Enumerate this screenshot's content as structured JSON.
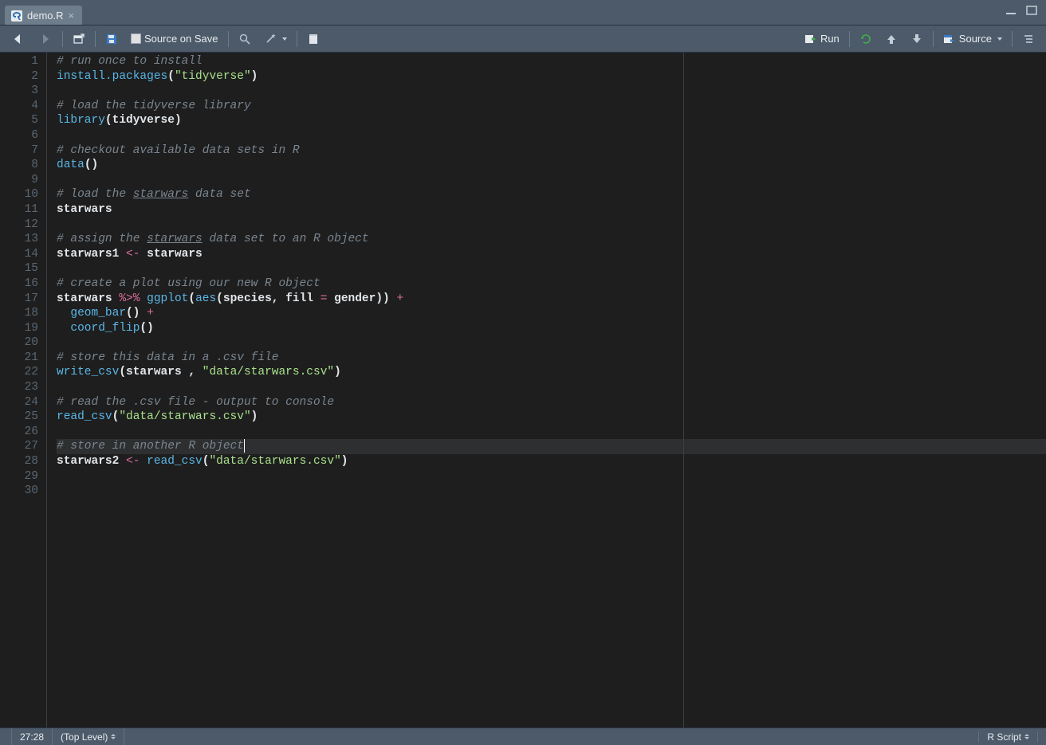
{
  "tab": {
    "filename": "demo.R"
  },
  "toolbar": {
    "source_on_save": "Source on Save",
    "run": "Run",
    "source": "Source"
  },
  "status": {
    "cursor_pos": "27:28",
    "scope": "(Top Level)",
    "file_type": "R Script"
  },
  "editor": {
    "active_line": 27,
    "total_lines": 30,
    "margin_col": 80,
    "lines": [
      {
        "n": 1,
        "tokens": [
          {
            "t": "# run once to install",
            "c": "cm"
          }
        ]
      },
      {
        "n": 2,
        "tokens": [
          {
            "t": "install.packages",
            "c": "fn"
          },
          {
            "t": "(",
            "c": "pun"
          },
          {
            "t": "\"tidyverse\"",
            "c": "str"
          },
          {
            "t": ")",
            "c": "pun"
          }
        ]
      },
      {
        "n": 3,
        "tokens": []
      },
      {
        "n": 4,
        "tokens": [
          {
            "t": "# load the tidyverse library",
            "c": "cm"
          }
        ]
      },
      {
        "n": 5,
        "tokens": [
          {
            "t": "library",
            "c": "fn"
          },
          {
            "t": "(",
            "c": "pun"
          },
          {
            "t": "tidyverse",
            "c": "id"
          },
          {
            "t": ")",
            "c": "pun"
          }
        ]
      },
      {
        "n": 6,
        "tokens": []
      },
      {
        "n": 7,
        "tokens": [
          {
            "t": "# checkout available data sets in R",
            "c": "cm"
          }
        ]
      },
      {
        "n": 8,
        "tokens": [
          {
            "t": "data",
            "c": "fn"
          },
          {
            "t": "()",
            "c": "pun"
          }
        ]
      },
      {
        "n": 9,
        "tokens": []
      },
      {
        "n": 10,
        "tokens": [
          {
            "t": "# load the ",
            "c": "cm"
          },
          {
            "t": "starwars",
            "c": "cm-u"
          },
          {
            "t": " data set",
            "c": "cm"
          }
        ]
      },
      {
        "n": 11,
        "tokens": [
          {
            "t": "starwars",
            "c": "id"
          }
        ]
      },
      {
        "n": 12,
        "tokens": []
      },
      {
        "n": 13,
        "tokens": [
          {
            "t": "# assign the ",
            "c": "cm"
          },
          {
            "t": "starwars",
            "c": "cm-u"
          },
          {
            "t": " data set to an R object",
            "c": "cm"
          }
        ]
      },
      {
        "n": 14,
        "tokens": [
          {
            "t": "starwars1 ",
            "c": "id"
          },
          {
            "t": "<-",
            "c": "op"
          },
          {
            "t": " starwars",
            "c": "id"
          }
        ]
      },
      {
        "n": 15,
        "tokens": []
      },
      {
        "n": 16,
        "tokens": [
          {
            "t": "# create a plot using our new R object",
            "c": "cm"
          }
        ]
      },
      {
        "n": 17,
        "tokens": [
          {
            "t": "starwars ",
            "c": "id"
          },
          {
            "t": "%>%",
            "c": "op"
          },
          {
            "t": " ",
            "c": "id"
          },
          {
            "t": "ggplot",
            "c": "fn"
          },
          {
            "t": "(",
            "c": "pun"
          },
          {
            "t": "aes",
            "c": "fn"
          },
          {
            "t": "(",
            "c": "pun"
          },
          {
            "t": "species",
            "c": "id"
          },
          {
            "t": ", ",
            "c": "pun"
          },
          {
            "t": "fill ",
            "c": "id"
          },
          {
            "t": "=",
            "c": "op"
          },
          {
            "t": " gender",
            "c": "id"
          },
          {
            "t": ")) ",
            "c": "pun"
          },
          {
            "t": "+",
            "c": "op"
          }
        ]
      },
      {
        "n": 18,
        "tokens": [
          {
            "t": "  ",
            "c": "id"
          },
          {
            "t": "geom_bar",
            "c": "fn"
          },
          {
            "t": "() ",
            "c": "pun"
          },
          {
            "t": "+",
            "c": "op"
          }
        ]
      },
      {
        "n": 19,
        "tokens": [
          {
            "t": "  ",
            "c": "id"
          },
          {
            "t": "coord_flip",
            "c": "fn"
          },
          {
            "t": "()",
            "c": "pun"
          }
        ]
      },
      {
        "n": 20,
        "tokens": []
      },
      {
        "n": 21,
        "tokens": [
          {
            "t": "# store this data in a .csv file",
            "c": "cm"
          }
        ]
      },
      {
        "n": 22,
        "tokens": [
          {
            "t": "write_csv",
            "c": "fn"
          },
          {
            "t": "(",
            "c": "pun"
          },
          {
            "t": "starwars ",
            "c": "id"
          },
          {
            "t": ", ",
            "c": "pun"
          },
          {
            "t": "\"data/starwars.csv\"",
            "c": "str"
          },
          {
            "t": ")",
            "c": "pun"
          }
        ]
      },
      {
        "n": 23,
        "tokens": []
      },
      {
        "n": 24,
        "tokens": [
          {
            "t": "# read the .csv file - output to console",
            "c": "cm"
          }
        ]
      },
      {
        "n": 25,
        "tokens": [
          {
            "t": "read_csv",
            "c": "fn"
          },
          {
            "t": "(",
            "c": "pun"
          },
          {
            "t": "\"data/starwars.csv\"",
            "c": "str"
          },
          {
            "t": ")",
            "c": "pun"
          }
        ]
      },
      {
        "n": 26,
        "tokens": []
      },
      {
        "n": 27,
        "tokens": [
          {
            "t": "# store in another R object",
            "c": "cm"
          }
        ],
        "cursor": true
      },
      {
        "n": 28,
        "tokens": [
          {
            "t": "starwars2 ",
            "c": "id"
          },
          {
            "t": "<-",
            "c": "op"
          },
          {
            "t": " ",
            "c": "id"
          },
          {
            "t": "read_csv",
            "c": "fn"
          },
          {
            "t": "(",
            "c": "pun"
          },
          {
            "t": "\"data/starwars.csv\"",
            "c": "str"
          },
          {
            "t": ")",
            "c": "pun"
          }
        ]
      },
      {
        "n": 29,
        "tokens": []
      },
      {
        "n": 30,
        "tokens": []
      }
    ]
  }
}
